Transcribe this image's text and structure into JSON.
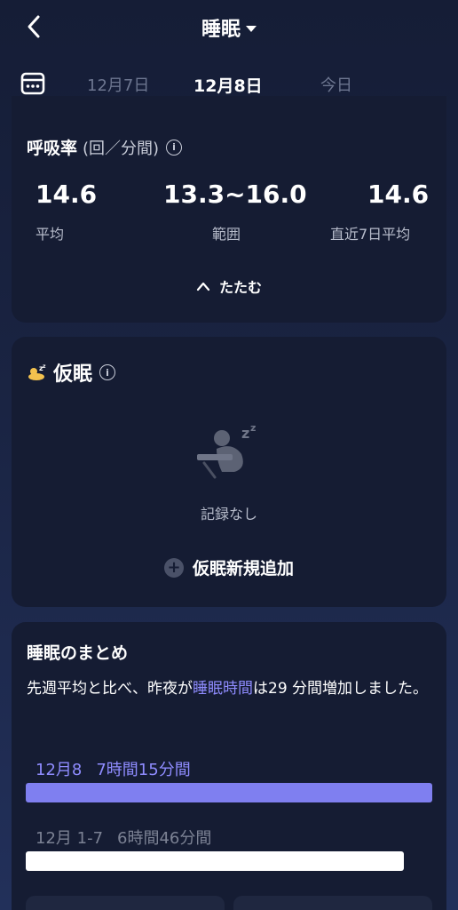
{
  "header": {
    "title": "睡眠"
  },
  "datebar": {
    "tabs": [
      {
        "label": "12月7日",
        "active": false
      },
      {
        "label": "12月8日",
        "active": true
      },
      {
        "label": "今日",
        "active": false
      }
    ]
  },
  "respiration": {
    "title": "呼吸率",
    "unit": "(回／分間)",
    "stats": [
      {
        "value": "14.6",
        "label": "平均"
      },
      {
        "value": "13.3~16.0",
        "label": "範囲"
      },
      {
        "value": "14.6",
        "label": "直近7日平均"
      }
    ],
    "collapse_label": "たたむ"
  },
  "nap": {
    "title": "仮眠",
    "empty_text": "記録なし",
    "add_label": "仮眠新規追加"
  },
  "summary": {
    "title": "睡眠のまとめ",
    "text_before": "先週平均と比べ、昨夜が",
    "text_highlight": "睡眠時間",
    "text_after": "は29 分間増加しました。",
    "bars": [
      {
        "date": "12月8",
        "duration": "7時間15分間",
        "fraction": 1.0,
        "color": "#7f7ff0",
        "label_color": "#8f8cff"
      },
      {
        "date": "12月 1-7",
        "duration": "6時間46分間",
        "fraction": 0.93,
        "color": "#ffffff",
        "label_color": "#7c8294"
      }
    ]
  },
  "colors": {
    "accent": "#8f8cff",
    "card": "#151c33",
    "muted": "#b7bccb"
  }
}
